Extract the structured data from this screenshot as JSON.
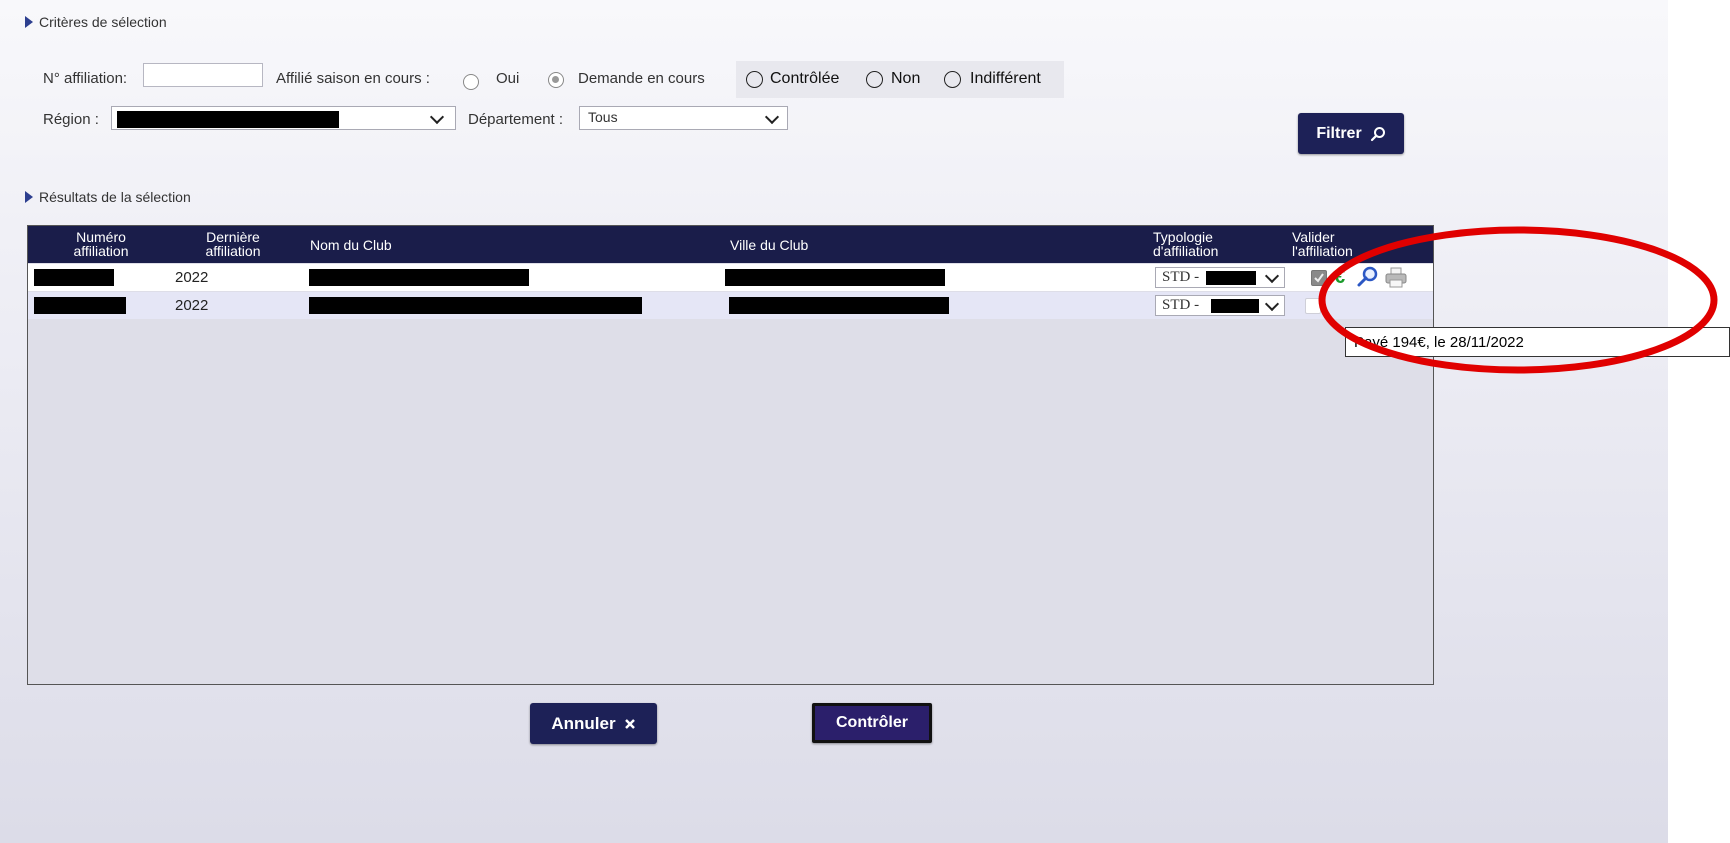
{
  "criteria": {
    "title": "Critères de sélection",
    "affiliation_number_label": "N° affiliation:",
    "affiliation_number_value": "",
    "season_label": "Affilié saison en cours :",
    "season_options": [
      "Oui",
      "Demande en cours",
      "Contrôlée",
      "Non",
      "Indifférent"
    ],
    "season_selected": "Demande en cours",
    "region_label": "Région :",
    "departement_label": "Département :",
    "departement_value": "Tous",
    "filter_button": "Filtrer"
  },
  "results": {
    "title": "Résultats de la sélection",
    "columns": {
      "numero_1": "Numéro",
      "numero_2": "affiliation",
      "derniere_1": "Dernière",
      "derniere_2": "affiliation",
      "nom": "Nom du Club",
      "ville": "Ville du Club",
      "typologie_1": "Typologie",
      "typologie_2": "d'affiliation",
      "valider_1": "Valider",
      "valider_2": "l'affiliation"
    },
    "rows": [
      {
        "derniere": "2022",
        "typologie": "STD -",
        "validated": true
      },
      {
        "derniere": "2022",
        "typologie": "STD -",
        "validated": false
      }
    ],
    "tooltip": "Payé 194€, le 28/11/2022"
  },
  "footer": {
    "cancel_button": "Annuler",
    "control_button": "Contrôler"
  },
  "icons": {
    "euro": "euro-icon",
    "search": "magnifier-icon",
    "print": "printer-icon",
    "filter": "search-icon",
    "cancel": "close-icon"
  },
  "colors": {
    "header_bg": "#1a1d4a",
    "button_bg": "#1d2157",
    "control_button_bg": "#2b1f6b",
    "euro": "#1a9a2a",
    "highlight_circle": "#e00000"
  }
}
